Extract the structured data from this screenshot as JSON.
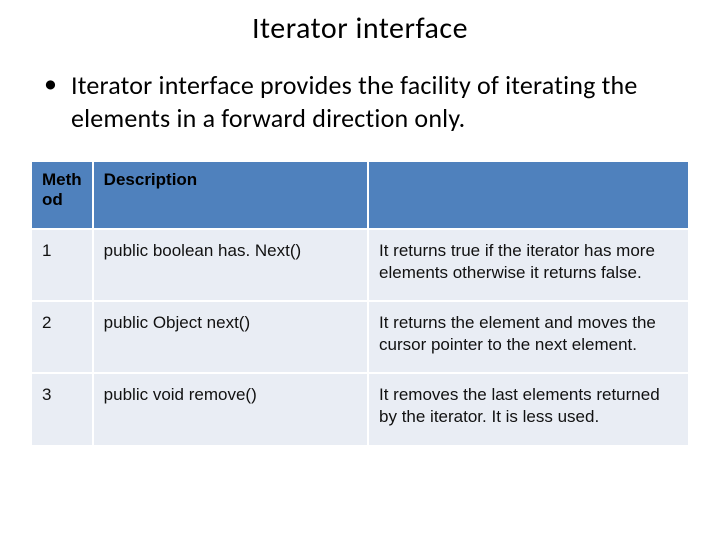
{
  "title": "Iterator interface",
  "bullet_text": "Iterator interface provides the facility of iterating the elements in a forward direction only.",
  "table": {
    "headers": {
      "col1": "Meth od",
      "col2": "Description",
      "col3": ""
    },
    "rows": [
      {
        "n": "1",
        "method": "public boolean has. Next()",
        "desc": "It returns true if the iterator has more elements otherwise it returns false."
      },
      {
        "n": "2",
        "method": "public Object next()",
        "desc": "It returns the element and moves the cursor pointer to the next element."
      },
      {
        "n": "3",
        "method": "public void remove()",
        "desc": "It removes the last elements returned by the iterator. It is less used."
      }
    ]
  }
}
